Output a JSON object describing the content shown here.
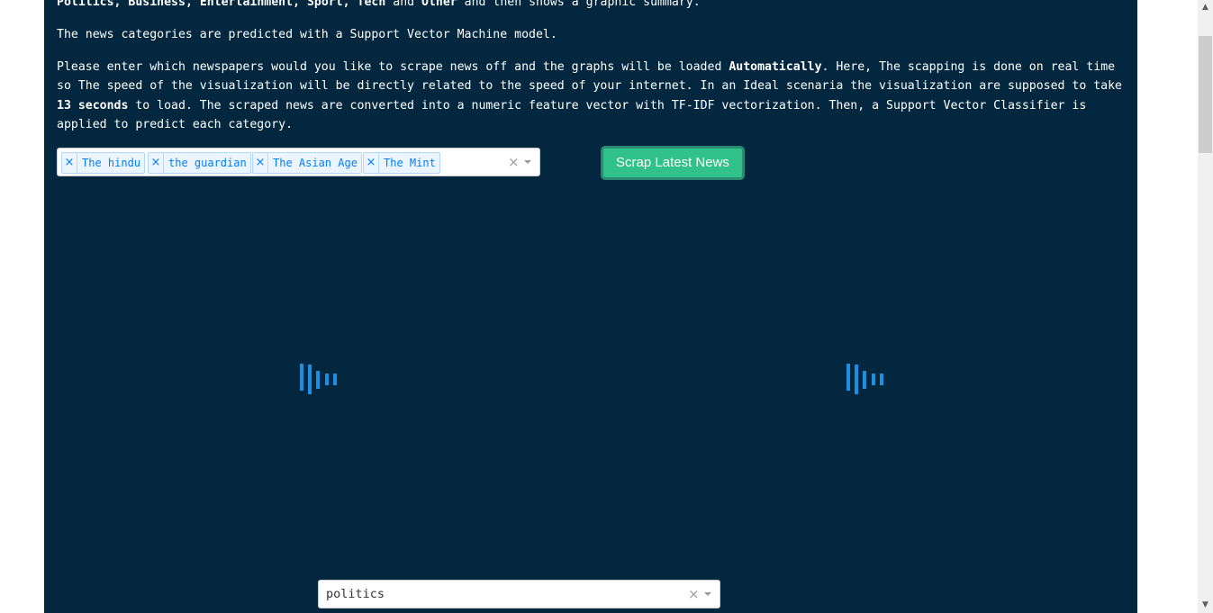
{
  "intro": {
    "line1_parts": [
      "Politics",
      ", ",
      "Business",
      ", ",
      "Entertainment",
      ", ",
      "Sport",
      ", ",
      "Tech",
      " and ",
      "Other",
      " and then shows a graphic summary."
    ],
    "line2": "The news categories are predicted with a Support Vector Machine model.",
    "line3_a": "Please enter which newspapers would you like to scrape news off and the graphs will be loaded ",
    "line3_bold1": "Automatically",
    "line3_b": ". Here, The scapping is done on real time so The speed of the visualization will be directly related to the speed of your internet. In an Ideal scenaria the visualization are supposed to take ",
    "line3_bold2": "13 seconds",
    "line3_c": " to load. The scraped news are converted into a numeric feature vector with TF-IDF vectorization. Then, a Support Vector Classifier is applied to predict each category."
  },
  "newspaper_select": {
    "selected": [
      "The hindu",
      "the guardian",
      "The Asian Age",
      "The Mint"
    ],
    "remove_glyph": "×",
    "clear_glyph": "×"
  },
  "scrap_button": {
    "label": "Scrap Latest News"
  },
  "category_select": {
    "value": "politics",
    "clear_glyph": "×"
  },
  "colors": {
    "panel_bg": "#042740",
    "button_bg": "#31c18a",
    "loader": "#1a8fe3",
    "tag_bg": "#ebf5ff",
    "tag_text": "#007eff"
  },
  "icons": {
    "loader": "loading-bars-icon",
    "dropdown": "chevron-down-icon",
    "remove": "close-icon"
  }
}
